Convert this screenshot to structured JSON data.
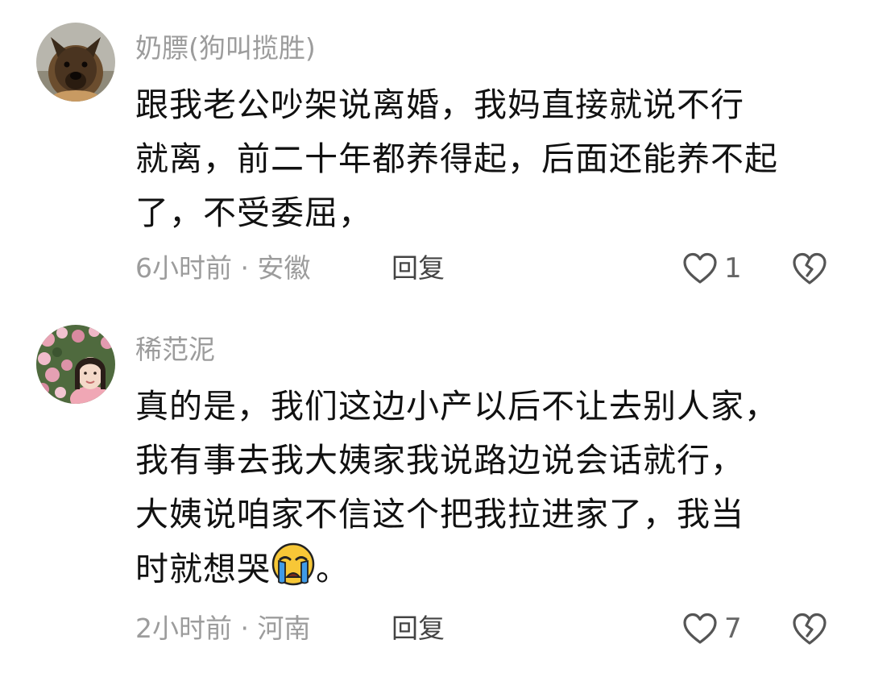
{
  "comments": [
    {
      "username": "奶膘(狗叫揽胜)",
      "avatar_icon": "dog-avatar",
      "lines": [
        "跟我老公吵架说离婚，我妈直接就说不行",
        "就离，前二十年都养得起，后面还能养不起",
        "了，不受委屈，"
      ],
      "meta": "6小时前 · 安徽",
      "reply_label": "回复",
      "likes": "1"
    },
    {
      "username": "稀范泥",
      "avatar_icon": "woman-flowers-avatar",
      "lines": [
        "真的是，我们这边小产以后不让去别人家，",
        "我有事去我大姨家我说路边说会话就行，",
        "大姨说咱家不信这个把我拉进家了，我当",
        "时就想哭"
      ],
      "line_suffix": "。",
      "emoji": "crying-face-emoji",
      "meta": "2小时前 · 河南",
      "reply_label": "回复",
      "likes": "7"
    }
  ],
  "colors": {
    "username": "#9c9c9c",
    "body": "#111111",
    "meta": "#9c9c9c",
    "icon": "#555555"
  }
}
